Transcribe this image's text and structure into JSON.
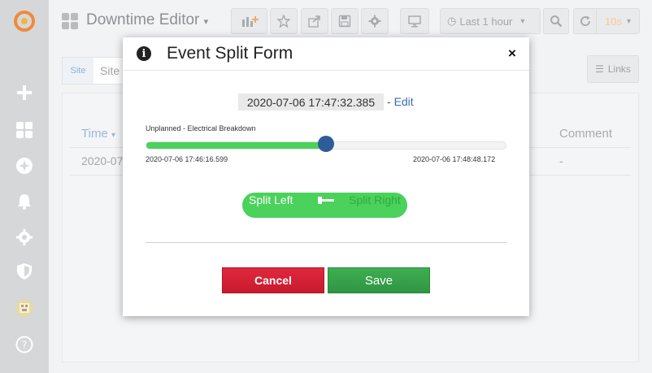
{
  "topbar": {
    "title": "Downtime Editor",
    "time_range": "Last 1 hour",
    "refresh_interval": "10s"
  },
  "page": {
    "site_label": "Site",
    "site_value": "Site",
    "links_label": "Links",
    "col_time": "Time",
    "col_comment": "Comment",
    "row_time": "2020-07",
    "row_comment": "-"
  },
  "modal": {
    "title": "Event Split Form",
    "close": "×",
    "split_timestamp": "2020-07-06 17:47:32.385",
    "edit_prefix": "- ",
    "edit_link": "Edit",
    "event_label": "Unplanned - Electrical Breakdown",
    "range_start": "2020-07-06 17:46:16.599",
    "range_end": "2020-07-06 17:48:48.172",
    "slider_position_fraction": 0.5,
    "toggle_left": "Split Left",
    "toggle_right": "Split Right",
    "cancel_label": "Cancel",
    "save_label": "Save"
  },
  "colors": {
    "accent_green": "#4ad25b",
    "cancel_red": "#d42136",
    "save_green": "#36a14a",
    "thumb_blue": "#2d5d99"
  }
}
